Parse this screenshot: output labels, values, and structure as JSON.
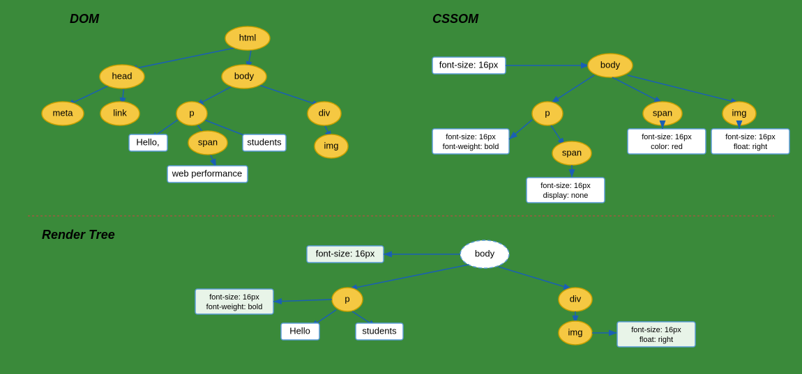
{
  "diagram": {
    "dom_title": "DOM",
    "cssom_title": "CSSOM",
    "render_title": "Render Tree",
    "dom_nodes": {
      "html": "html",
      "head": "head",
      "body": "body",
      "meta": "meta",
      "link": "link",
      "p": "p",
      "span_dom": "span",
      "div": "div",
      "img_dom": "img",
      "hello": "Hello,",
      "students": "students",
      "web_performance": "web performance"
    },
    "cssom_nodes": {
      "body": "body",
      "p": "p",
      "span1": "span",
      "img": "img",
      "span2": "span",
      "font_size_body": "font-size: 16px",
      "font_size_p": "font-size: 16px\nfont-weight: bold",
      "font_size_span1": "font-size: 16px\ncolor: red",
      "font_size_img": "font-size: 16px\nfloat: right",
      "font_size_span2": "font-size: 16px\ndisplay: none"
    },
    "render_nodes": {
      "body": "body",
      "p": "p",
      "div": "div",
      "img": "img",
      "hello": "Hello",
      "students": "students",
      "font_size_body": "font-size: 16px",
      "font_size_p": "font-size: 16px\nfont-weight: bold",
      "font_size_img": "font-size: 16px\nfloat: right"
    }
  }
}
